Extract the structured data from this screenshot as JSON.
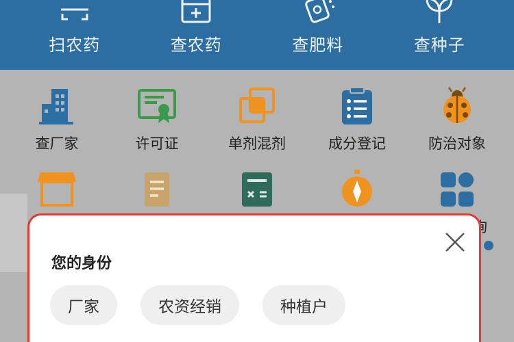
{
  "top_nav": [
    {
      "label": "扫农药",
      "icon": "scan-icon"
    },
    {
      "label": "查农药",
      "icon": "medicine-box-icon"
    },
    {
      "label": "查肥料",
      "icon": "fertilizer-bag-icon"
    },
    {
      "label": "查种子",
      "icon": "plant-icon"
    }
  ],
  "grid_row1": [
    {
      "label": "查厂家",
      "icon": "building-icon"
    },
    {
      "label": "许可证",
      "icon": "certificate-icon"
    },
    {
      "label": "单剂混剂",
      "icon": "overlap-squares-icon"
    },
    {
      "label": "成分登记",
      "icon": "clipboard-icon"
    },
    {
      "label": "防治对象",
      "icon": "ladybug-icon"
    }
  ],
  "grid_row2_partial_label": "询",
  "modal": {
    "title": "您的身份",
    "options": [
      "厂家",
      "农资经销",
      "种植户"
    ]
  },
  "colors": {
    "primary": "#2c6da2",
    "highlight_border": "#e53935",
    "green": "#3b9a4a",
    "orange": "#f0921e"
  }
}
